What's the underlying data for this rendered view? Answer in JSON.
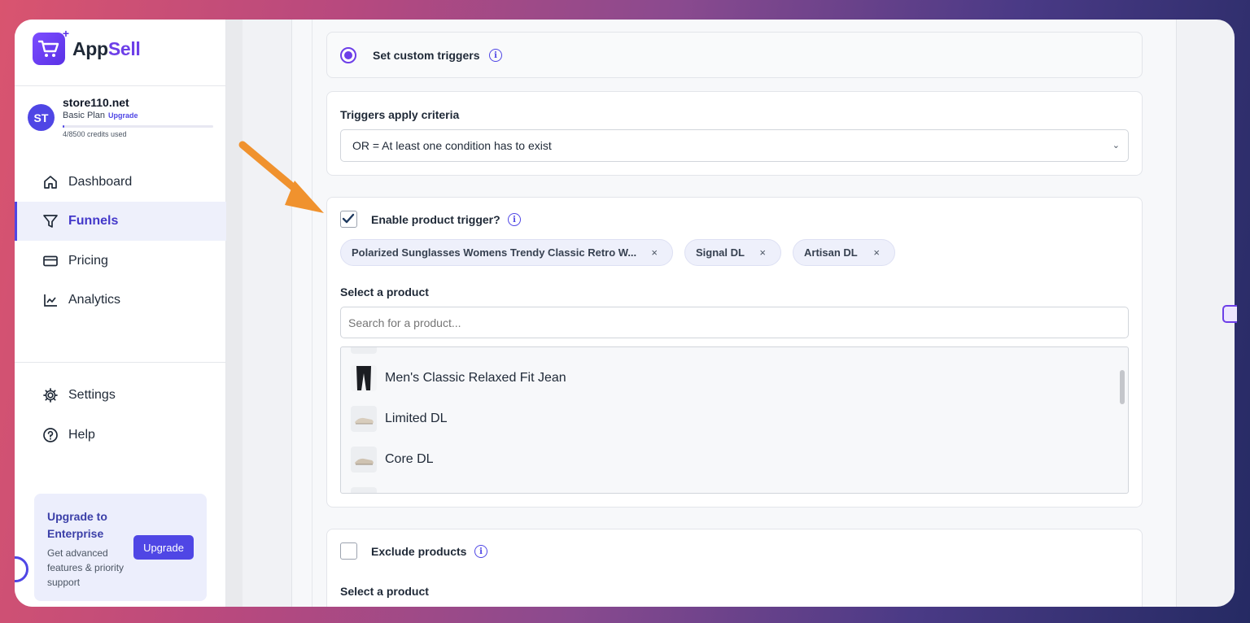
{
  "brand": {
    "name_part1": "App",
    "name_part2": "Sell"
  },
  "account": {
    "initials": "ST",
    "store": "store110.net",
    "plan": "Basic Plan",
    "upgrade_link": "Upgrade",
    "credits_text": "4/8500 credits used",
    "credits_fraction": 0.0005
  },
  "nav": {
    "dashboard": "Dashboard",
    "funnels": "Funnels",
    "pricing": "Pricing",
    "analytics": "Analytics",
    "settings": "Settings",
    "help": "Help"
  },
  "promo": {
    "title": "Upgrade to Enterprise",
    "description": "Get advanced features & priority support",
    "button": "Upgrade"
  },
  "custom_triggers": {
    "label": "Set custom triggers",
    "selected": true
  },
  "criteria": {
    "label": "Triggers apply criteria",
    "value": "OR = At least one condition has to exist"
  },
  "product_trigger": {
    "label": "Enable product trigger?",
    "checked": true,
    "chips": [
      "Polarized Sunglasses Womens Trendy Classic Retro W...",
      "Signal DL",
      "Artisan DL"
    ],
    "select_label": "Select a product",
    "search_placeholder": "Search for a product...",
    "products": [
      "Men's Classic Relaxed Fit Jean",
      "Limited DL",
      "Core DL"
    ]
  },
  "exclude": {
    "label": "Exclude products",
    "checked": false,
    "select_label": "Select a product"
  },
  "colors": {
    "accent": "#4f46e5",
    "purple": "#6d3fe8",
    "arrow": "#f0922e"
  },
  "icons": [
    "cart-icon",
    "home-icon",
    "funnel-icon",
    "card-icon",
    "chart-icon",
    "gear-icon",
    "help-icon",
    "info-icon",
    "check-icon",
    "close-icon",
    "chevron-down-icon"
  ]
}
